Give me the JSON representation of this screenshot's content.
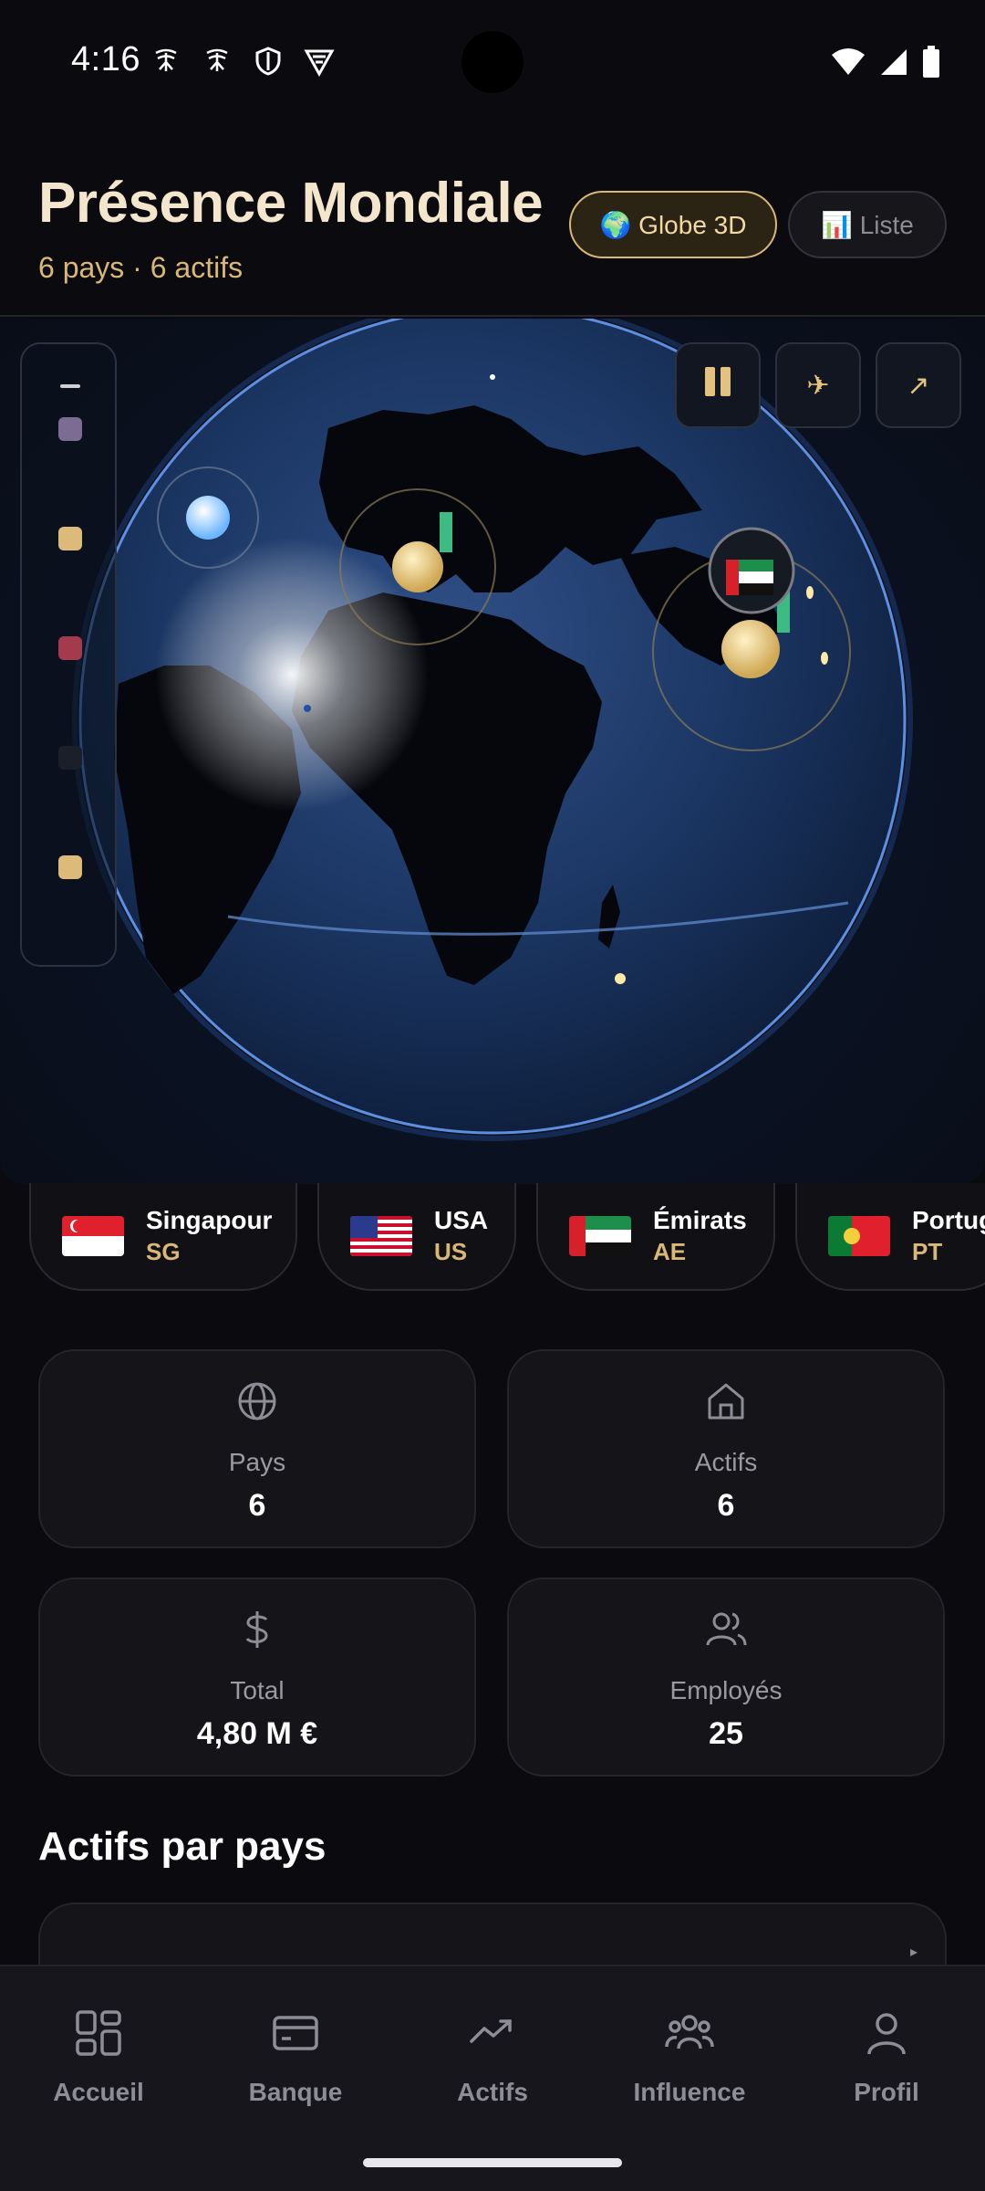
{
  "status_bar": {
    "time": "4:16"
  },
  "header": {
    "title": "Présence Mondiale",
    "subtitle": "6 pays · 6 actifs",
    "toggle_globe": "🌍 Globe 3D",
    "toggle_list": "📊 Liste"
  },
  "globe": {
    "controls": [
      {
        "icon": "pause-icon"
      },
      {
        "icon": "plane-icon",
        "glyph": "✈"
      },
      {
        "icon": "expand-arrow-icon",
        "glyph": "↗"
      }
    ],
    "legend_colors": [
      "#7c6c93",
      "#dcbb7a",
      "#a33a4e",
      "#1b1f29",
      "#dcbb7a"
    ],
    "marker_flag": "ae"
  },
  "countries": [
    {
      "name": "Singapour",
      "code": "SG"
    },
    {
      "name": "USA",
      "code": "US"
    },
    {
      "name": "Émirats",
      "code": "AE"
    },
    {
      "name": "Portug",
      "code": "PT"
    }
  ],
  "stats": [
    {
      "label": "Pays",
      "value": "6",
      "icon": "globe-icon"
    },
    {
      "label": "Actifs",
      "value": "6",
      "icon": "home-icon"
    },
    {
      "label": "Total",
      "value": "4,80 M €",
      "icon": "dollar-icon"
    },
    {
      "label": "Employés",
      "value": "25",
      "icon": "users-icon"
    }
  ],
  "section": {
    "title": "Actifs par pays"
  },
  "nav": [
    {
      "label": "Accueil",
      "icon": "dashboard-icon"
    },
    {
      "label": "Banque",
      "icon": "card-icon"
    },
    {
      "label": "Actifs",
      "icon": "trending-icon"
    },
    {
      "label": "Influence",
      "icon": "people-icon"
    },
    {
      "label": "Profil",
      "icon": "user-icon"
    }
  ],
  "colors": {
    "gold": "#d9b777",
    "background": "#0b0b0f",
    "card": "#141419"
  }
}
